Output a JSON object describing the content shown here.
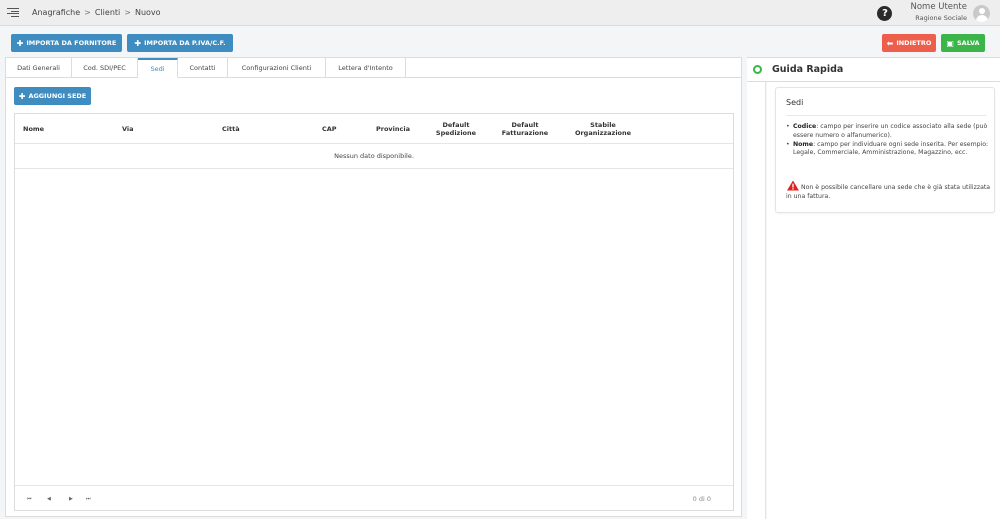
{
  "topbar": {
    "breadcrumb": [
      "Anagrafiche",
      "Clienti",
      "Nuovo"
    ],
    "separator": ">",
    "help_label": "?",
    "user_name": "Nome Utente",
    "user_company": "Ragione Sociale"
  },
  "actions": {
    "import_supplier": "IMPORTA DA FORNITORE",
    "import_vat": "IMPORTA DA P.IVA/C.F.",
    "back": "INDIETRO",
    "save": "SALVA",
    "add_site": "AGGIUNGI SEDE"
  },
  "tabs": [
    {
      "label": "Dati Generali",
      "active": false
    },
    {
      "label": "Cod. SDI/PEC",
      "active": false
    },
    {
      "label": "Sedi",
      "active": true
    },
    {
      "label": "Contatti",
      "active": false
    },
    {
      "label": "Configurazioni Clienti",
      "active": false
    },
    {
      "label": "Lettera d'Intento",
      "active": false
    }
  ],
  "table": {
    "columns": {
      "nome": "Nome",
      "via": "Via",
      "citta": "Città",
      "cap": "CAP",
      "provincia": "Provincia",
      "default_spedizione_1": "Default",
      "default_spedizione_2": "Spedizione",
      "default_fatturazione_1": "Default",
      "default_fatturazione_2": "Fatturazione",
      "stabile_1": "Stabile",
      "stabile_2": "Organizzazione"
    },
    "empty_message": "Nessun dato disponibile.",
    "pager": {
      "first": "⏮",
      "prev": "◀",
      "next": "▶",
      "last": "⏭"
    },
    "count": "0 di 0"
  },
  "guide": {
    "title": "Guida Rapida",
    "card_title": "Sedi",
    "items": [
      {
        "term": "Codice",
        "text": ": campo per inserire un codice associato alla sede (può essere numero o alfanumerico)."
      },
      {
        "term": "Nome",
        "text": ": campo per individuare ogni sede inserita. Per esempio: Legale, Commerciale, Amministrazione, Magazzino, ecc."
      }
    ],
    "warning": "Non è possibile cancellare una sede che è già stata utilizzata in una fattura."
  },
  "colors": {
    "primary": "#3f8cc0",
    "danger": "#ee5f4b",
    "success": "#3bb54a"
  }
}
